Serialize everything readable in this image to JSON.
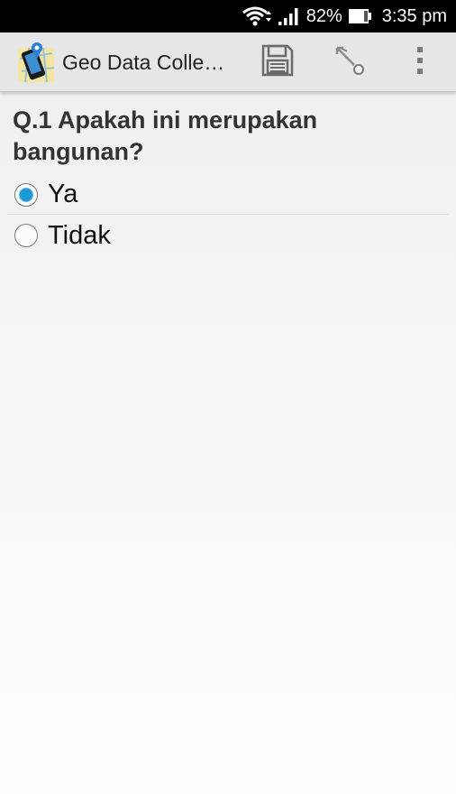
{
  "status_bar": {
    "battery": "82%",
    "time": "3:35 pm"
  },
  "action_bar": {
    "title": "Geo Data Colle…",
    "icons": [
      "app-map-icon",
      "save-floppy-icon",
      "location-pin-icon",
      "overflow-menu-icon"
    ]
  },
  "form": {
    "question": "Q.1 Apakah ini merupakan bangunan?",
    "options": [
      {
        "label": "Ya",
        "selected": true
      },
      {
        "label": "Tidak",
        "selected": false
      }
    ]
  },
  "colors": {
    "accent": "#1e9ad8",
    "status_bar_bg": "#000000",
    "action_bar_bg": "#e6e6e6"
  }
}
